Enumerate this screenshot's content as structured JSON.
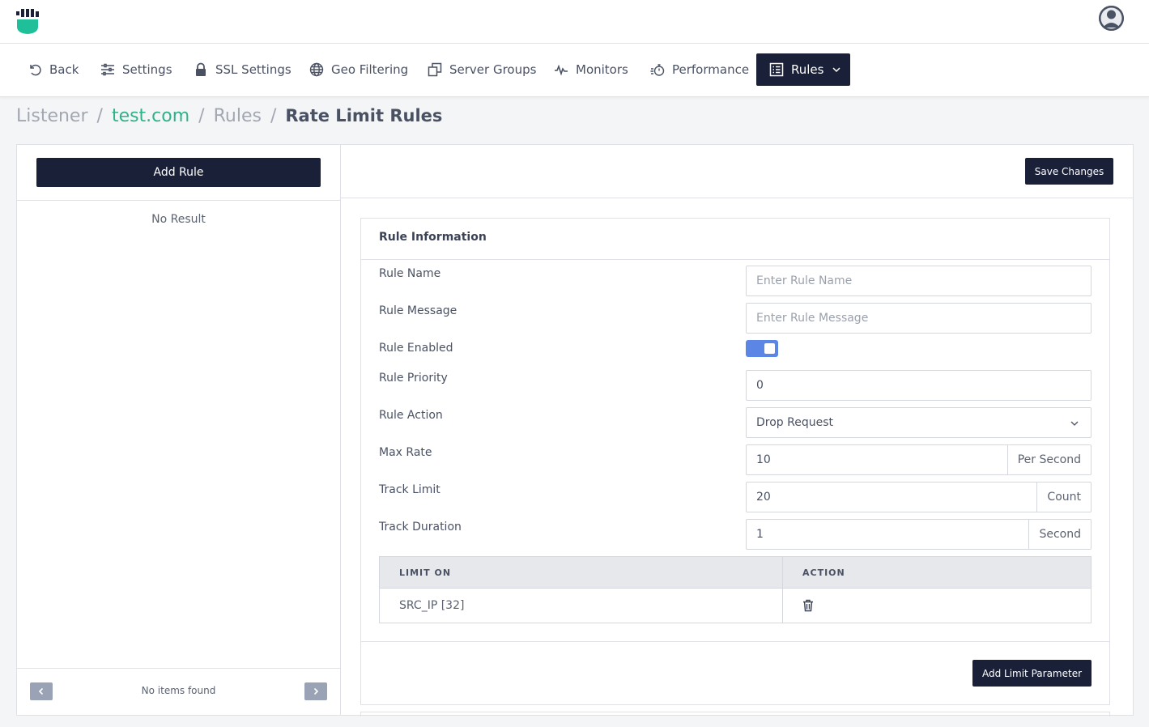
{
  "nav": {
    "items": [
      {
        "label": "Back",
        "icon": "undo-icon"
      },
      {
        "label": "Settings",
        "icon": "sliders-icon"
      },
      {
        "label": "SSL Settings",
        "icon": "lock-icon"
      },
      {
        "label": "Geo Filtering",
        "icon": "globe-icon"
      },
      {
        "label": "Server Groups",
        "icon": "copy-icon"
      },
      {
        "label": "Monitors",
        "icon": "pulse-icon"
      },
      {
        "label": "Performance",
        "icon": "stopwatch-icon"
      },
      {
        "label": "Rules",
        "icon": "list-icon",
        "active": true
      }
    ]
  },
  "breadcrumb": {
    "listener": "Listener",
    "sep": "/",
    "domain": "test.com",
    "rules": "Rules",
    "current": "Rate Limit Rules"
  },
  "left": {
    "add_rule_label": "Add Rule",
    "no_result": "No Result",
    "pager_text": "No items found"
  },
  "right": {
    "save_label": "Save Changes",
    "card_title": "Rule Information",
    "fields": {
      "rule_name": {
        "label": "Rule Name",
        "placeholder": "Enter Rule Name"
      },
      "rule_message": {
        "label": "Rule Message",
        "placeholder": "Enter Rule Message"
      },
      "rule_enabled": {
        "label": "Rule Enabled",
        "value": true
      },
      "rule_priority": {
        "label": "Rule Priority",
        "value": "0"
      },
      "rule_action": {
        "label": "Rule Action",
        "value": "Drop Request"
      },
      "max_rate": {
        "label": "Max Rate",
        "value": "10",
        "unit": "Per Second"
      },
      "track_limit": {
        "label": "Track Limit",
        "value": "20",
        "unit": "Count"
      },
      "track_duration": {
        "label": "Track Duration",
        "value": "1",
        "unit": "Second"
      }
    },
    "limits_table": {
      "headers": [
        "LIMIT ON",
        "ACTION"
      ],
      "rows": [
        {
          "limit_on": "SRC_IP [32]",
          "action_icon": "trash-icon"
        }
      ]
    },
    "add_limit_label": "Add Limit Parameter"
  },
  "colors": {
    "navy": "#1a2038",
    "accent_green": "#2fb28a",
    "toggle_blue": "#5b86e5",
    "logo_teal": "#1fbf9a"
  }
}
